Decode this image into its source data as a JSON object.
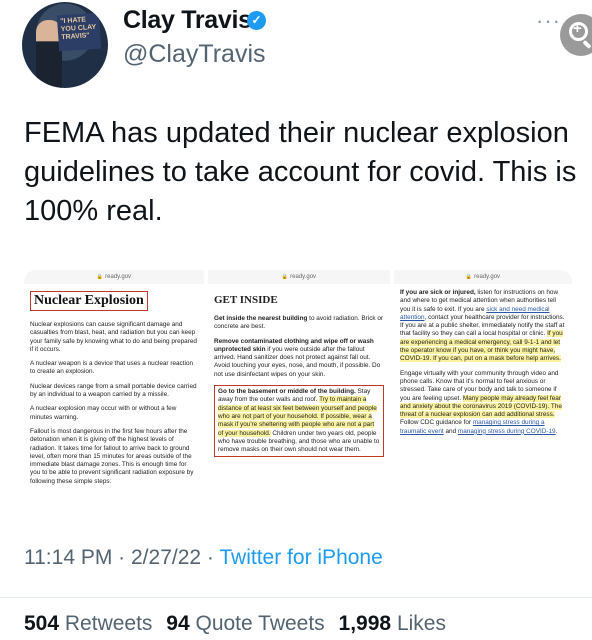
{
  "author": {
    "name": "Clay Travis",
    "handle": "@ClayTravis",
    "avatar_sign_text": "\"I HATE YOU CLAY TRAVIS\""
  },
  "tweet": {
    "text": "FEMA has updated their nuclear explosion guidelines to take account for covid. This is 100% real."
  },
  "media": {
    "panels": [
      {
        "url": "ready.gov",
        "heading": "Nuclear Explosion",
        "paragraphs": [
          "Nuclear explosions can cause significant damage and casualties from blast, heat, and radiation but you can keep your family safe by knowing what to do and being prepared if it occurs.",
          "A nuclear weapon is a device that uses a nuclear reaction to create an explosion.",
          "Nuclear devices range from a small portable device carried by an individual to a weapon carried by a missile.",
          "A nuclear explosion may occur with or without a few minutes warning.",
          "Fallout is most dangerous in the first few hours after the detonation when it is giving off the highest levels of radiation. It takes time for fallout to arrive back to ground level, often more than 15 minutes for areas outside of the immediate blast damage zones. This is enough time for you to be able to prevent significant radiation exposure by following these simple steps:"
        ]
      },
      {
        "url": "ready.gov",
        "heading": "GET INSIDE",
        "p1_bold": "Get inside the nearest building",
        "p1_rest": " to avoid radiation. Brick or concrete are best.",
        "p2_bold": "Remove contaminated clothing and wipe off or wash unprotected skin",
        "p2_rest": " if you were outside after the fallout arrived. Hand sanitizer does not protect against fall out. Avoid touching your eyes, nose, and mouth, if possible. Do not use disinfectant wipes on your skin.",
        "p3_bold": "Go to the basement or middle of the building.",
        "p3_a": " Stay away from the outer walls and roof. ",
        "p3_hl": "Try to maintain a distance of at least six feet between yourself and people who are not part of your household. If possible, wear a mask if you're sheltering with people who are not a part of your household.",
        "p3_b": " Children under two years old, people who have trouble breathing, and those who are unable to remove masks on their own should not wear them."
      },
      {
        "url": "ready.gov",
        "p1_bold": "If you are sick or injured,",
        "p1_a": " listen for instructions on how and where to get medical attention when authorities tell you it is safe to exit. If you are ",
        "p1_link": "sick and need medical attention",
        "p1_b": ", contact your healthcare provider for instructions. If you are at a public shelter, immediately notify the staff at that facility so they can call a local hospital or clinic. ",
        "p1_hl": "If you are experiencing a medical emergency, call 9-1-1 and let the operator know if you have, or think you might have, COVID-19. If you can, put on a mask before help arrives.",
        "p2_a": "Engage virtually with your community through video and phone calls. Know that it's normal to feel anxious or stressed. Take care of your body and talk to someone if you are feeling upset. ",
        "p2_hl": "Many people may already feel fear and anxiety about the coronavirus 2019 (COVID-19). The threat of a nuclear explosion can add additional stress.",
        "p2_b": " Follow CDC guidance for ",
        "p2_link1": "managing stress during a traumatic event",
        "p2_c": " and ",
        "p2_link2": "managing stress during COVID-19",
        "p2_d": "."
      }
    ]
  },
  "meta": {
    "time": "11:14 PM",
    "sep1": " · ",
    "date": "2/27/22",
    "sep2": " · ",
    "app": "Twitter for iPhone"
  },
  "stats": {
    "retweets": "504",
    "retweets_label": "Retweets",
    "quotes": "94",
    "quotes_label": "Quote Tweets",
    "likes": "1,998",
    "likes_label": "Likes"
  },
  "icons": {
    "verified": "verified-badge-icon",
    "more": "more-options-icon",
    "zoom": "zoom-in-icon",
    "lock": "lock-icon"
  },
  "colors": {
    "twitter_blue": "#1d9bf0",
    "muted_text": "#536471",
    "highlight": "#fbf3a0",
    "red_box": "#c0392b"
  }
}
